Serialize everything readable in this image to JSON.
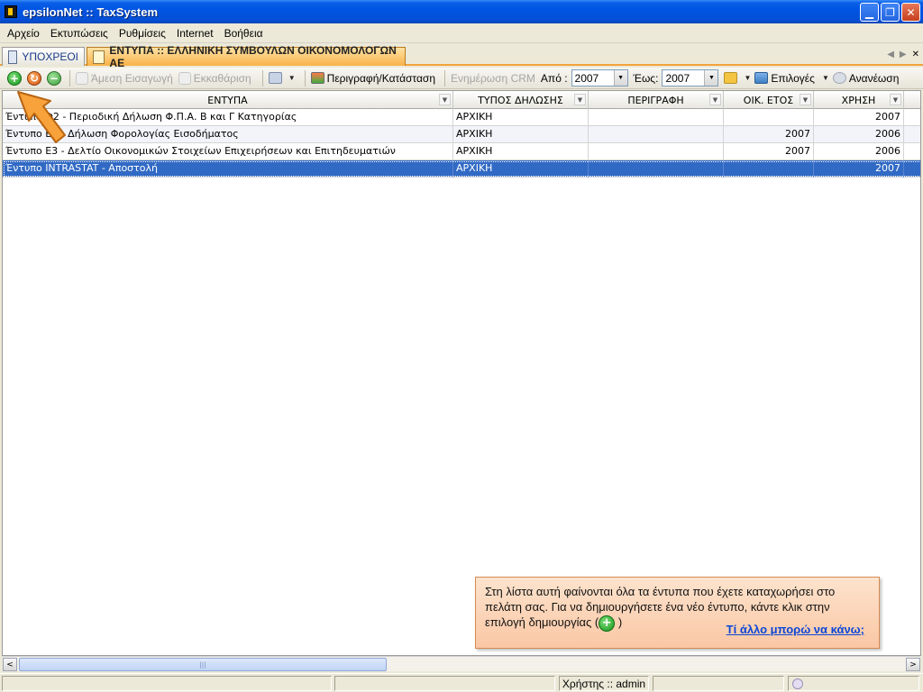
{
  "window": {
    "title": "epsilonNet :: TaxSystem",
    "buttons": {
      "minimize": "▁",
      "restore": "❐",
      "close": "✕"
    }
  },
  "menu": [
    "Αρχείο",
    "Εκτυπώσεις",
    "Ρυθμίσεις",
    "Internet",
    "Βοήθεια"
  ],
  "tabs": {
    "inactive": "ΥΠΟΧΡΕΟΙ",
    "active": "ΕΝΤΥΠΑ :: ΕΛΛΗΝΙΚΗ ΣΥΜΒΟΥΛΩΝ ΟΙΚΟΝΟΜΟΛΟΓΩΝ ΑΕ",
    "nav_prev": "◀",
    "nav_next": "▶",
    "nav_close": "✕"
  },
  "toolbar": {
    "add_glyph": "+",
    "refresh_glyph": "↻",
    "remove_glyph": "−",
    "direct_entry": "Άμεση Εισαγωγή",
    "clear": "Εκκαθάριση",
    "description_status": "Περιγραφή/Κατάσταση",
    "crm_update": "Ενημέρωση CRM",
    "from_label": "Από :",
    "from_value": "2007",
    "to_label": "Έως:",
    "to_value": "2007",
    "options": "Επιλογές",
    "refresh": "Ανανέωση",
    "dropdown_arrow": "▼"
  },
  "grid": {
    "columns": [
      "ΕΝΤΥΠΑ",
      "ΤΥΠΟΣ ΔΗΛΩΣΗΣ",
      "ΠΕΡΙΓΡΑΦΗ",
      "ΟΙΚ. ΕΤΟΣ",
      "ΧΡΗΣΗ"
    ],
    "filter_glyph": "▼",
    "rows": [
      {
        "form": "Έντυπο Φ2 - Περιοδική Δήλωση Φ.Π.Α. Β και Γ Κατηγορίας",
        "type": "ΑΡΧΙΚΗ",
        "description": "",
        "fiscal_year": "",
        "usage": "2007"
      },
      {
        "form": "Έντυπο Ε1 - Δήλωση Φορολογίας Εισοδήματος",
        "type": "ΑΡΧΙΚΗ",
        "description": "",
        "fiscal_year": "2007",
        "usage": "2006"
      },
      {
        "form": "Έντυπο Ε3 - Δελτίο Οικονομικών Στοιχείων Επιχειρήσεων και Επιτηδευματιών",
        "type": "ΑΡΧΙΚΗ",
        "description": "",
        "fiscal_year": "2007",
        "usage": "2006"
      },
      {
        "form": "Έντυπο INTRASTAT - Αποστολή",
        "type": "ΑΡΧΙΚΗ",
        "description": "",
        "fiscal_year": "",
        "usage": "2007"
      }
    ]
  },
  "help": {
    "text": "Στη λίστα αυτή φαίνονται όλα τα έντυπα που έχετε καταχωρήσει στο πελάτη σας. Για να δημιουργήσετε ένα νέο έντυπο, κάντε κλικ στην επιλογή δημιουργίας (",
    "text_end": ")",
    "link": "Τί άλλο μπορώ να κάνω;"
  },
  "scrollbar": {
    "left": "<",
    "right": ">",
    "grip": "|||"
  },
  "status": {
    "user": "Χρήστης :: admin"
  },
  "colors": {
    "accent": "#f2a33a",
    "selection": "#316ac5",
    "titlebar": "#0054e3"
  }
}
